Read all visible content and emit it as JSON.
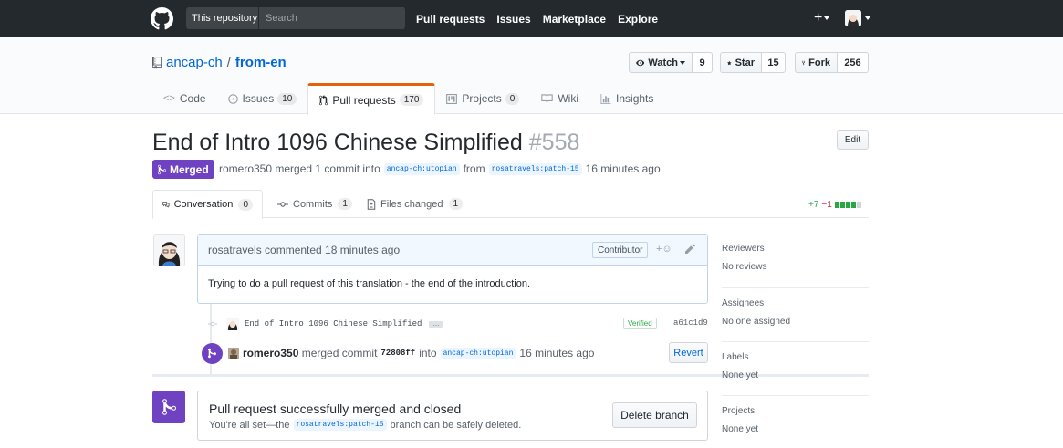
{
  "header": {
    "search_scope": "This repository",
    "search_placeholder": "Search",
    "nav": [
      "Pull requests",
      "Issues",
      "Marketplace",
      "Explore"
    ],
    "plus": "+"
  },
  "repo": {
    "owner": "ancap-ch",
    "separator": "/",
    "name": "from-en",
    "watch_label": "Watch",
    "watch_count": "9",
    "star_label": "Star",
    "star_count": "15",
    "fork_label": "Fork",
    "fork_count": "256",
    "tabs": [
      {
        "label": "Code",
        "counter": ""
      },
      {
        "label": "Issues",
        "counter": "10"
      },
      {
        "label": "Pull requests",
        "counter": "170"
      },
      {
        "label": "Projects",
        "counter": "0"
      },
      {
        "label": "Wiki",
        "counter": ""
      },
      {
        "label": "Insights",
        "counter": ""
      }
    ]
  },
  "pr": {
    "title": "End of Intro 1096 Chinese Simplified",
    "number": "#558",
    "edit_label": "Edit",
    "state": "Merged",
    "meta_author": "romero350",
    "meta_text1": "merged 1 commit into",
    "base_branch": "ancap-ch:utopian",
    "meta_from": "from",
    "head_branch": "rosatravels:patch-15",
    "meta_time": "16 minutes ago",
    "tabs": [
      {
        "label": "Conversation",
        "counter": "0"
      },
      {
        "label": "Commits",
        "counter": "1"
      },
      {
        "label": "Files changed",
        "counter": "1"
      }
    ],
    "additions": "+7",
    "deletions": "−1"
  },
  "comment": {
    "author": "rosatravels",
    "action": "commented 18 minutes ago",
    "badge": "Contributor",
    "react": "+☺",
    "body": "Trying to do a pull request of this translation - the end of the introduction."
  },
  "commit": {
    "message": "End of Intro 1096 Chinese Simplified",
    "ellipsis": "…",
    "verified": "Verified",
    "sha": "a61c1d9"
  },
  "merge_event": {
    "author": "romero350",
    "text1": "merged commit",
    "sha": "72808ff",
    "text2": "into",
    "branch": "ancap-ch:utopian",
    "time": "16 minutes ago",
    "revert_label": "Revert"
  },
  "merged_box": {
    "title": "Pull request successfully merged and closed",
    "sub1": "You're all set—the",
    "branch": "rosatravels:patch-15",
    "sub2": "branch can be safely deleted.",
    "delete_label": "Delete branch"
  },
  "sidebar": [
    {
      "heading": "Reviewers",
      "value": "No reviews"
    },
    {
      "heading": "Assignees",
      "value": "No one assigned"
    },
    {
      "heading": "Labels",
      "value": "None yet"
    },
    {
      "heading": "Projects",
      "value": "None yet"
    }
  ],
  "colors": {
    "header_bg": "#24292e",
    "merged_purple": "#6f42c1",
    "link_blue": "#0366d6",
    "tab_accent": "#e36209",
    "add_green": "#28a745",
    "del_red": "#cb2431"
  }
}
